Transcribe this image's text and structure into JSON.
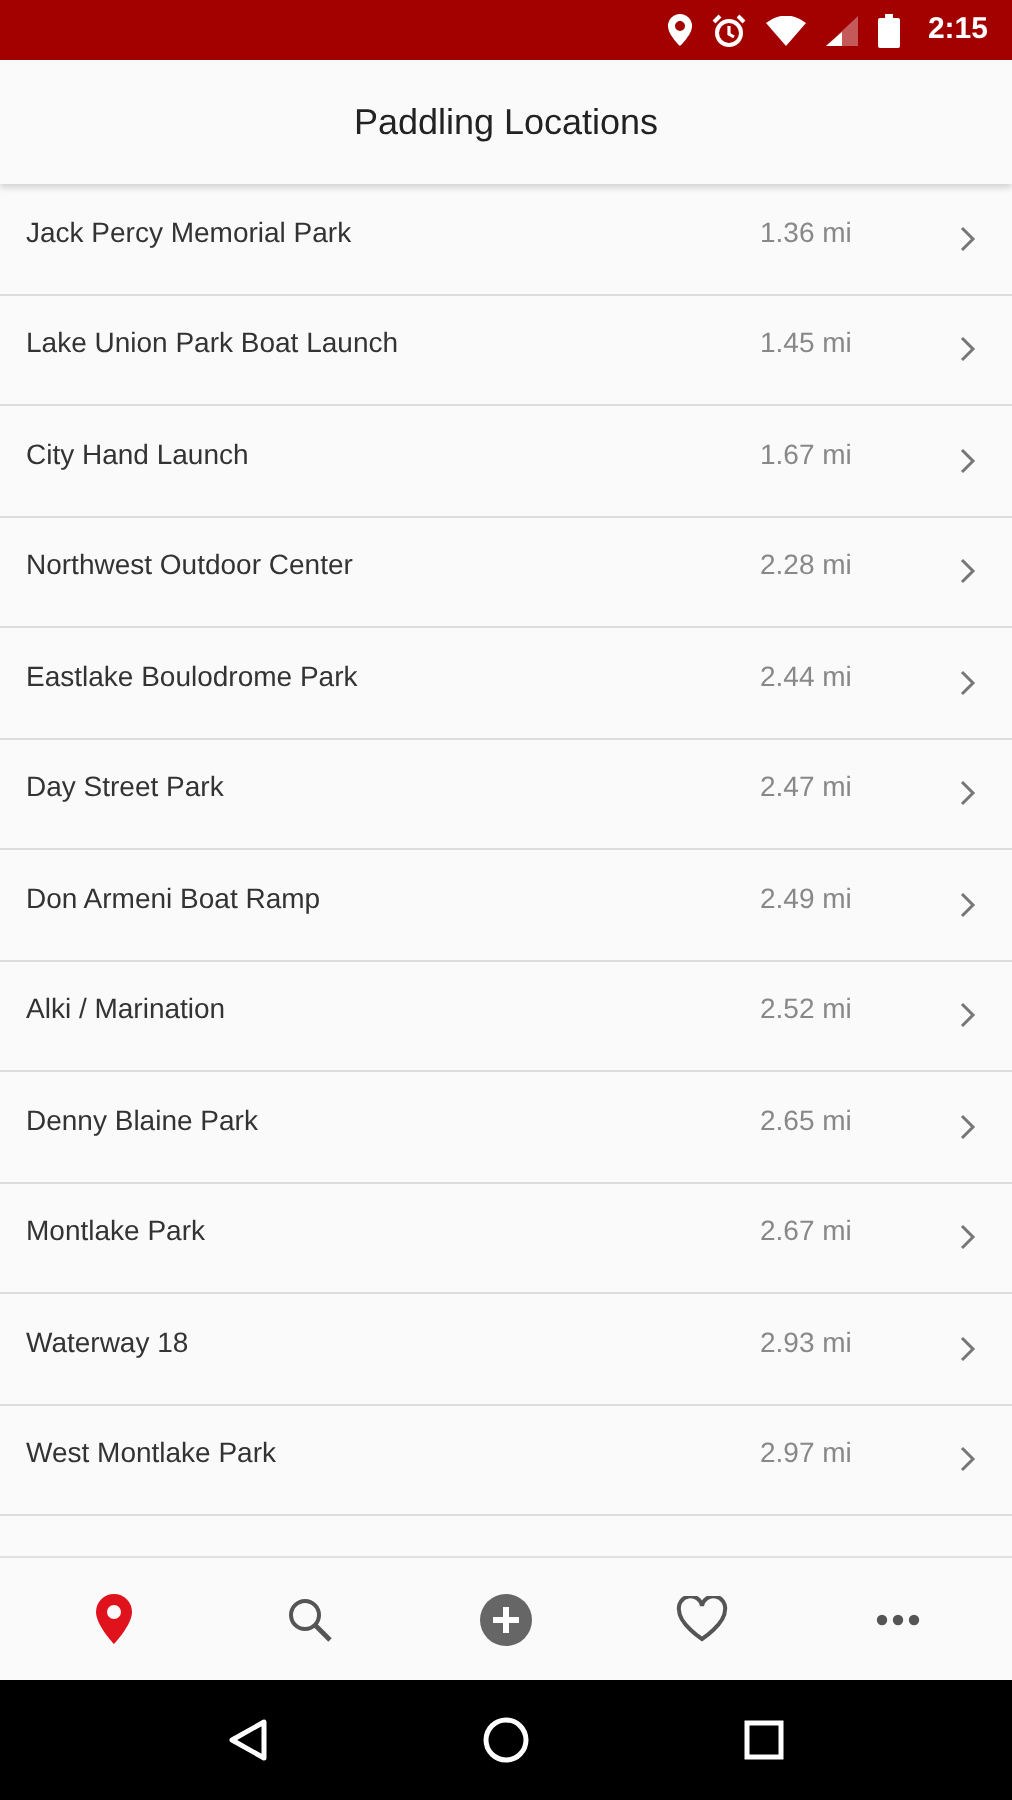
{
  "status_bar": {
    "time": "2:15"
  },
  "header": {
    "title": "Paddling Locations"
  },
  "locations": [
    {
      "name": "Jack Percy Memorial Park",
      "distance": "1.36 mi"
    },
    {
      "name": "Lake Union Park Boat Launch",
      "distance": "1.45 mi"
    },
    {
      "name": "City Hand Launch",
      "distance": "1.67 mi"
    },
    {
      "name": "Northwest Outdoor Center",
      "distance": "2.28 mi"
    },
    {
      "name": "Eastlake Boulodrome Park",
      "distance": "2.44 mi"
    },
    {
      "name": "Day Street Park",
      "distance": "2.47 mi"
    },
    {
      "name": "Don Armeni Boat Ramp",
      "distance": "2.49 mi"
    },
    {
      "name": "Alki / Marination",
      "distance": "2.52 mi"
    },
    {
      "name": "Denny Blaine Park",
      "distance": "2.65 mi"
    },
    {
      "name": "Montlake Park",
      "distance": "2.67 mi"
    },
    {
      "name": "Waterway 18",
      "distance": "2.93 mi"
    },
    {
      "name": "West Montlake Park",
      "distance": "2.97 mi"
    }
  ],
  "bottom_nav": [
    {
      "kind": "locations",
      "selected": true
    },
    {
      "kind": "search",
      "selected": false
    },
    {
      "kind": "add",
      "selected": false
    },
    {
      "kind": "favorites",
      "selected": false
    },
    {
      "kind": "more",
      "selected": false
    }
  ]
}
